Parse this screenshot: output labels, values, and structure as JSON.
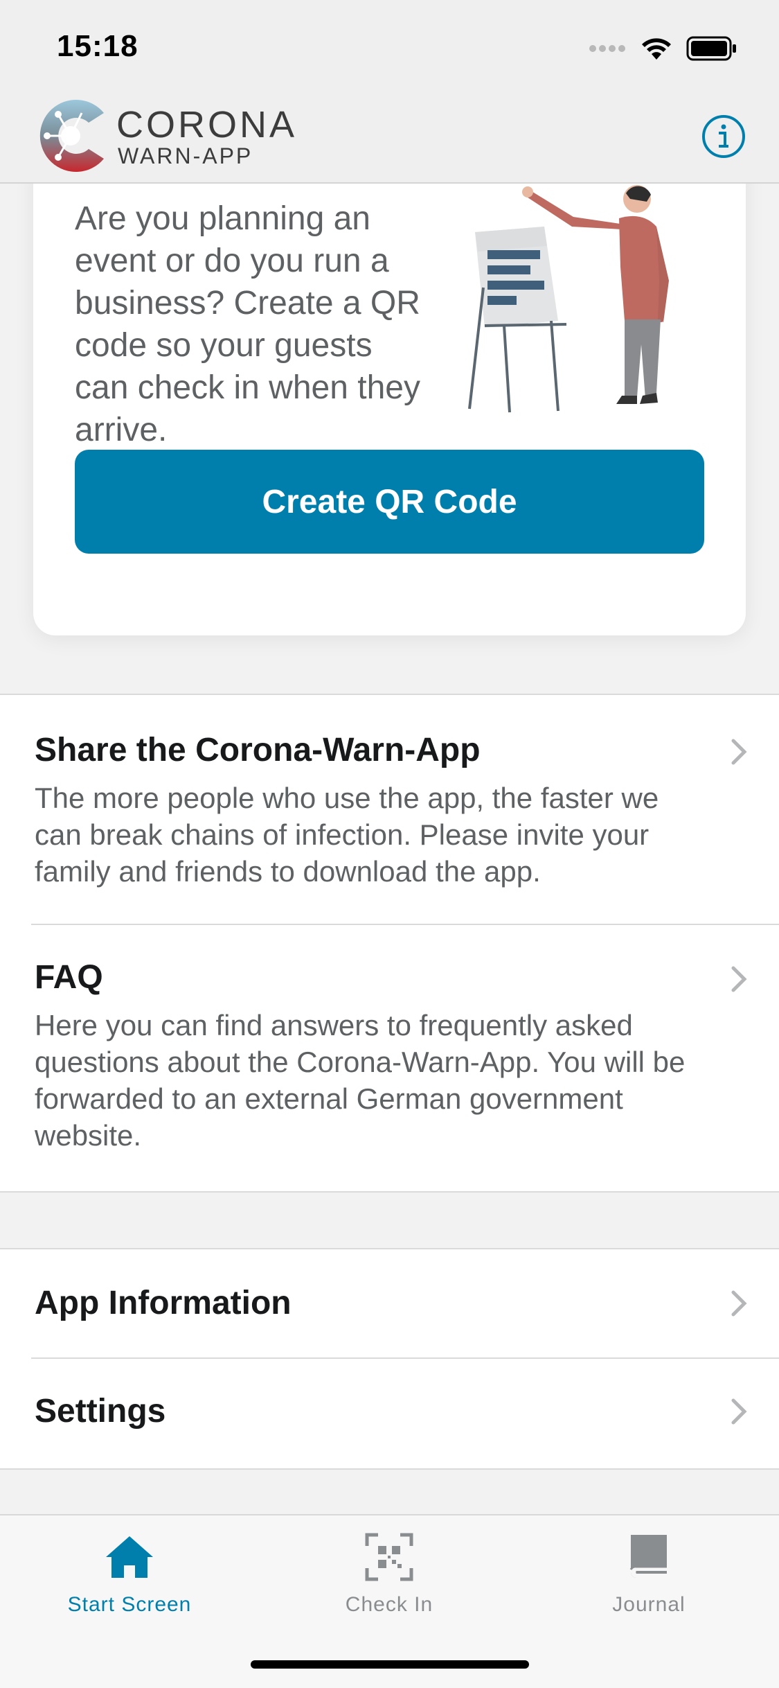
{
  "status_bar": {
    "time": "15:18"
  },
  "header": {
    "logo_line1": "CORONA",
    "logo_line2": "WARN-APP"
  },
  "event_card": {
    "text": "Are you planning an event or do you run a business? Create a QR code so your guests can check in when they arrive.",
    "button_label": "Create QR Code"
  },
  "menu": {
    "share": {
      "title": "Share the Corona-Warn-App",
      "description": "The more people who use the app, the faster we can break chains of infection. Please invite your family and friends to download the app."
    },
    "faq": {
      "title": "FAQ",
      "description": "Here you can find answers to frequently asked questions about the Corona-Warn-App. You will be forwarded to an external German government website."
    },
    "app_info": {
      "title": "App Information"
    },
    "settings": {
      "title": "Settings"
    }
  },
  "tabs": [
    {
      "label": "Start Screen",
      "icon": "home-icon",
      "active": true
    },
    {
      "label": "Check In",
      "icon": "qr-scan-icon",
      "active": false
    },
    {
      "label": "Journal",
      "icon": "book-icon",
      "active": false
    }
  ],
  "colors": {
    "accent": "#007fad",
    "text_primary": "#17191a",
    "text_secondary": "#5e6163",
    "tab_inactive": "#8a8d8f"
  }
}
